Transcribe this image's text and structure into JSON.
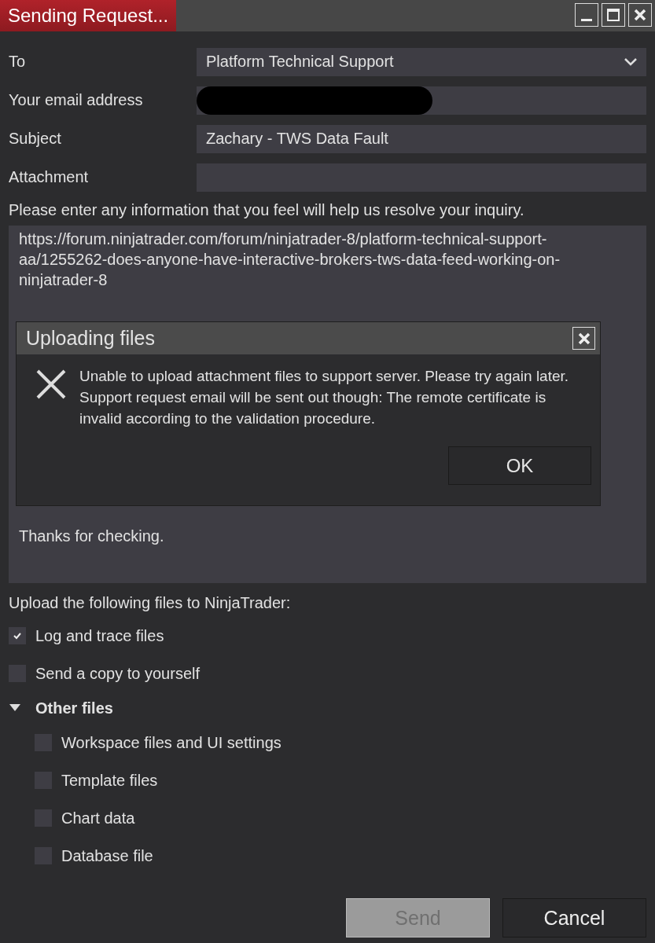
{
  "window": {
    "title": "Sending Request..."
  },
  "form": {
    "to_label": "To",
    "to_value": "Platform Technical Support",
    "email_label": "Your email address",
    "email_redacted": true,
    "subject_label": "Subject",
    "subject_value": "Zachary - TWS Data Fault",
    "attachment_label": "Attachment"
  },
  "message": {
    "prompt": "Please enter any information that you feel will help us resolve your inquiry.",
    "paragraphs": [
      "https://forum.ninjatrader.com/forum/ninjatrader-8/platform-technical-support-aa/1255262-does-anyone-have-interactive-brokers-tws-data-feed-working-on-ninjatrader-8",
      "Thanks for checking."
    ]
  },
  "dialog": {
    "title": "Uploading files",
    "text": "Unable to upload attachment files to support server. Please try again later. Support request email will be sent out though: The remote certificate is invalid according to the validation procedure.",
    "button": "OK"
  },
  "upload": {
    "label": "Upload the following files to NinjaTrader:",
    "options": [
      {
        "label": "Log and trace files",
        "checked": true
      },
      {
        "label": "Send a copy to yourself",
        "checked": false
      }
    ],
    "group": {
      "label": "Other files",
      "expanded": true,
      "children": [
        {
          "label": "Workspace files and UI settings",
          "checked": false
        },
        {
          "label": "Template files",
          "checked": false
        },
        {
          "label": "Chart data",
          "checked": false
        },
        {
          "label": "Database file",
          "checked": false
        }
      ]
    }
  },
  "buttons": [
    {
      "label": "Send",
      "disabled": true
    },
    {
      "label": "Cancel",
      "disabled": false
    }
  ]
}
